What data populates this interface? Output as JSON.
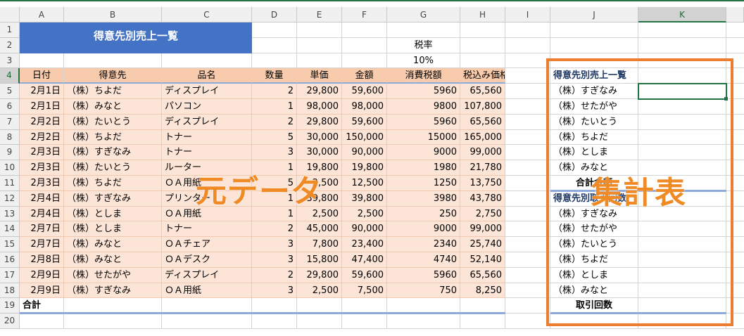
{
  "sheet": {
    "columns": [
      "A",
      "B",
      "C",
      "D",
      "E",
      "F",
      "G",
      "H",
      "I",
      "J",
      "K"
    ],
    "rows": [
      "1",
      "2",
      "3",
      "4",
      "5",
      "6",
      "7",
      "8",
      "9",
      "10",
      "11",
      "12",
      "13",
      "14",
      "15",
      "16",
      "17",
      "18",
      "19",
      "20"
    ],
    "selected_column": "K",
    "selected_row": "4"
  },
  "title": "得意先別売上一覧",
  "tax": {
    "label": "税率",
    "value": "10%"
  },
  "table": {
    "headers": [
      "日付",
      "得意先",
      "品名",
      "数量",
      "単価",
      "金額",
      "消費税額",
      "税込み価格"
    ],
    "rows": [
      [
        "2月1日",
        "（株）ちよだ",
        "ディスプレイ",
        "2",
        "29,800",
        "59,600",
        "5960",
        "65,560"
      ],
      [
        "2月1日",
        "（株）みなと",
        "パソコン",
        "1",
        "98,000",
        "98,000",
        "9800",
        "107,800"
      ],
      [
        "2月2日",
        "（株）たいとう",
        "ディスプレイ",
        "2",
        "29,800",
        "59,600",
        "5960",
        "65,560"
      ],
      [
        "2月2日",
        "（株）ちよだ",
        "トナー",
        "5",
        "30,000",
        "150,000",
        "15000",
        "165,000"
      ],
      [
        "2月3日",
        "（株）すぎなみ",
        "トナー",
        "3",
        "30,000",
        "90,000",
        "9000",
        "99,000"
      ],
      [
        "2月3日",
        "（株）たいとう",
        "ルーター",
        "1",
        "19,800",
        "19,800",
        "1980",
        "21,780"
      ],
      [
        "2月3日",
        "（株）ちよだ",
        "ＯＡ用紙",
        "5",
        "2,500",
        "12,500",
        "1250",
        "13,750"
      ],
      [
        "2月4日",
        "（株）すぎなみ",
        "プリンター",
        "1",
        "39,800",
        "39,800",
        "3980",
        "43,780"
      ],
      [
        "2月4日",
        "（株）としま",
        "ＯＡ用紙",
        "1",
        "2,500",
        "2,500",
        "250",
        "2,750"
      ],
      [
        "2月7日",
        "（株）としま",
        "トナー",
        "2",
        "45,000",
        "90,000",
        "9000",
        "99,000"
      ],
      [
        "2月7日",
        "（株）みなと",
        "ＯＡチェア",
        "3",
        "7,800",
        "23,400",
        "2340",
        "25,740"
      ],
      [
        "2月8日",
        "（株）みなと",
        "ＯＡデスク",
        "3",
        "15,800",
        "47,400",
        "4740",
        "52,140"
      ],
      [
        "2月9日",
        "（株）せたがや",
        "ディスプレイ",
        "2",
        "29,800",
        "59,600",
        "5960",
        "65,560"
      ],
      [
        "2月9日",
        "（株）すぎなみ",
        "ＯＡ用紙",
        "3",
        "2,500",
        "7,500",
        "750",
        "8,250"
      ]
    ],
    "total_label": "合計"
  },
  "summary1": {
    "title": "得意先別売上一覧",
    "customers": [
      "（株）すぎなみ",
      "（株）せたがや",
      "（株）たいとう",
      "（株）ちよだ",
      "（株）としま",
      "（株）みなと"
    ],
    "total_label": "合計金額"
  },
  "summary2": {
    "title": "得意先別取引回数",
    "customers": [
      "（株）すぎなみ",
      "（株）せたがや",
      "（株）たいとう",
      "（株）ちよだ",
      "（株）としま",
      "（株）みなと"
    ],
    "total_label": "取引回数"
  },
  "overlays": {
    "source_label": "元データ",
    "summary_label": "集計表"
  },
  "colors": {
    "title_banner": "#4472c4",
    "header_fill": "#f8cbad",
    "data_fill": "#fce4d6",
    "accent_orange": "#ed7d31",
    "excel_green": "#217346"
  }
}
